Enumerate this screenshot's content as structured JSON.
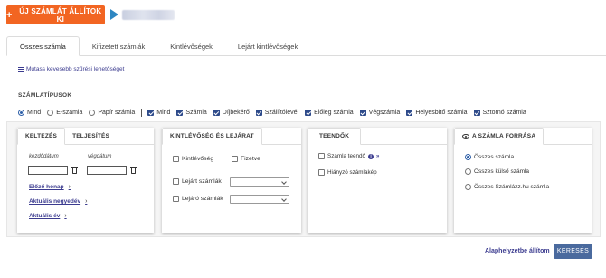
{
  "header": {
    "new_button_label": "ÚJ SZÁMLÁT ÁLLÍTOK KI",
    "new_button_icon": "plus-icon",
    "play_icon": "play-icon",
    "accent_color": "#f26522"
  },
  "tabs": [
    {
      "label": "Összes számla",
      "active": true
    },
    {
      "label": "Kifizetett számlák",
      "active": false
    },
    {
      "label": "Kintlévőségek",
      "active": false
    },
    {
      "label": "Lejárt kintlévőségek",
      "active": false
    }
  ],
  "filters": {
    "less_filters_link": "Mutass kevesebb szűrési lehetőséget",
    "invoice_types_title": "SZÁMLATÍPUSOK",
    "radio_options": [
      {
        "label": "Mind",
        "selected": true
      },
      {
        "label": "E-számla",
        "selected": false
      },
      {
        "label": "Papír számla",
        "selected": false
      }
    ],
    "checkbox_options": [
      {
        "label": "Mind",
        "checked": true
      },
      {
        "label": "Számla",
        "checked": true
      },
      {
        "label": "Díjbekérő",
        "checked": true
      },
      {
        "label": "Szállítólevél",
        "checked": true
      },
      {
        "label": "Előleg számla",
        "checked": true
      },
      {
        "label": "Végszámla",
        "checked": true
      },
      {
        "label": "Helyesbítő számla",
        "checked": true
      },
      {
        "label": "Sztornó számla",
        "checked": true
      }
    ]
  },
  "date_card": {
    "tabs": [
      "KELTEZÉS",
      "TELJESÍTÉS"
    ],
    "start_label": "kezdődátum",
    "end_label": "végdátum",
    "start_value": "",
    "end_value": "",
    "links": [
      "Előző hónap",
      "Aktuális negyedév",
      "Aktuális év"
    ]
  },
  "due_card": {
    "title": "KINTLÉVŐSÉG ÉS LEJÁRAT",
    "outstanding_label": "Kintlévőség",
    "paid_label": "Fizetve",
    "expired_label": "Lejárt számlák",
    "expiring_label": "Lejáró számlák",
    "expired_select": "",
    "expiring_select": ""
  },
  "todo_card": {
    "title": "TEENDŐK",
    "invoice_todo_label": "Számla teendő",
    "missing_image_label": "Hiányzó számlakép"
  },
  "source_card": {
    "title": "A SZÁMLA FORRÁSA",
    "options": [
      {
        "label": "Összes számla",
        "selected": true
      },
      {
        "label": "Összes külső számla",
        "selected": false
      },
      {
        "label": "Összes Számlázz.hu számla",
        "selected": false
      }
    ]
  },
  "actions": {
    "reset_label": "Alaphelyzetbe állítom",
    "search_label": "KERESÉS"
  }
}
